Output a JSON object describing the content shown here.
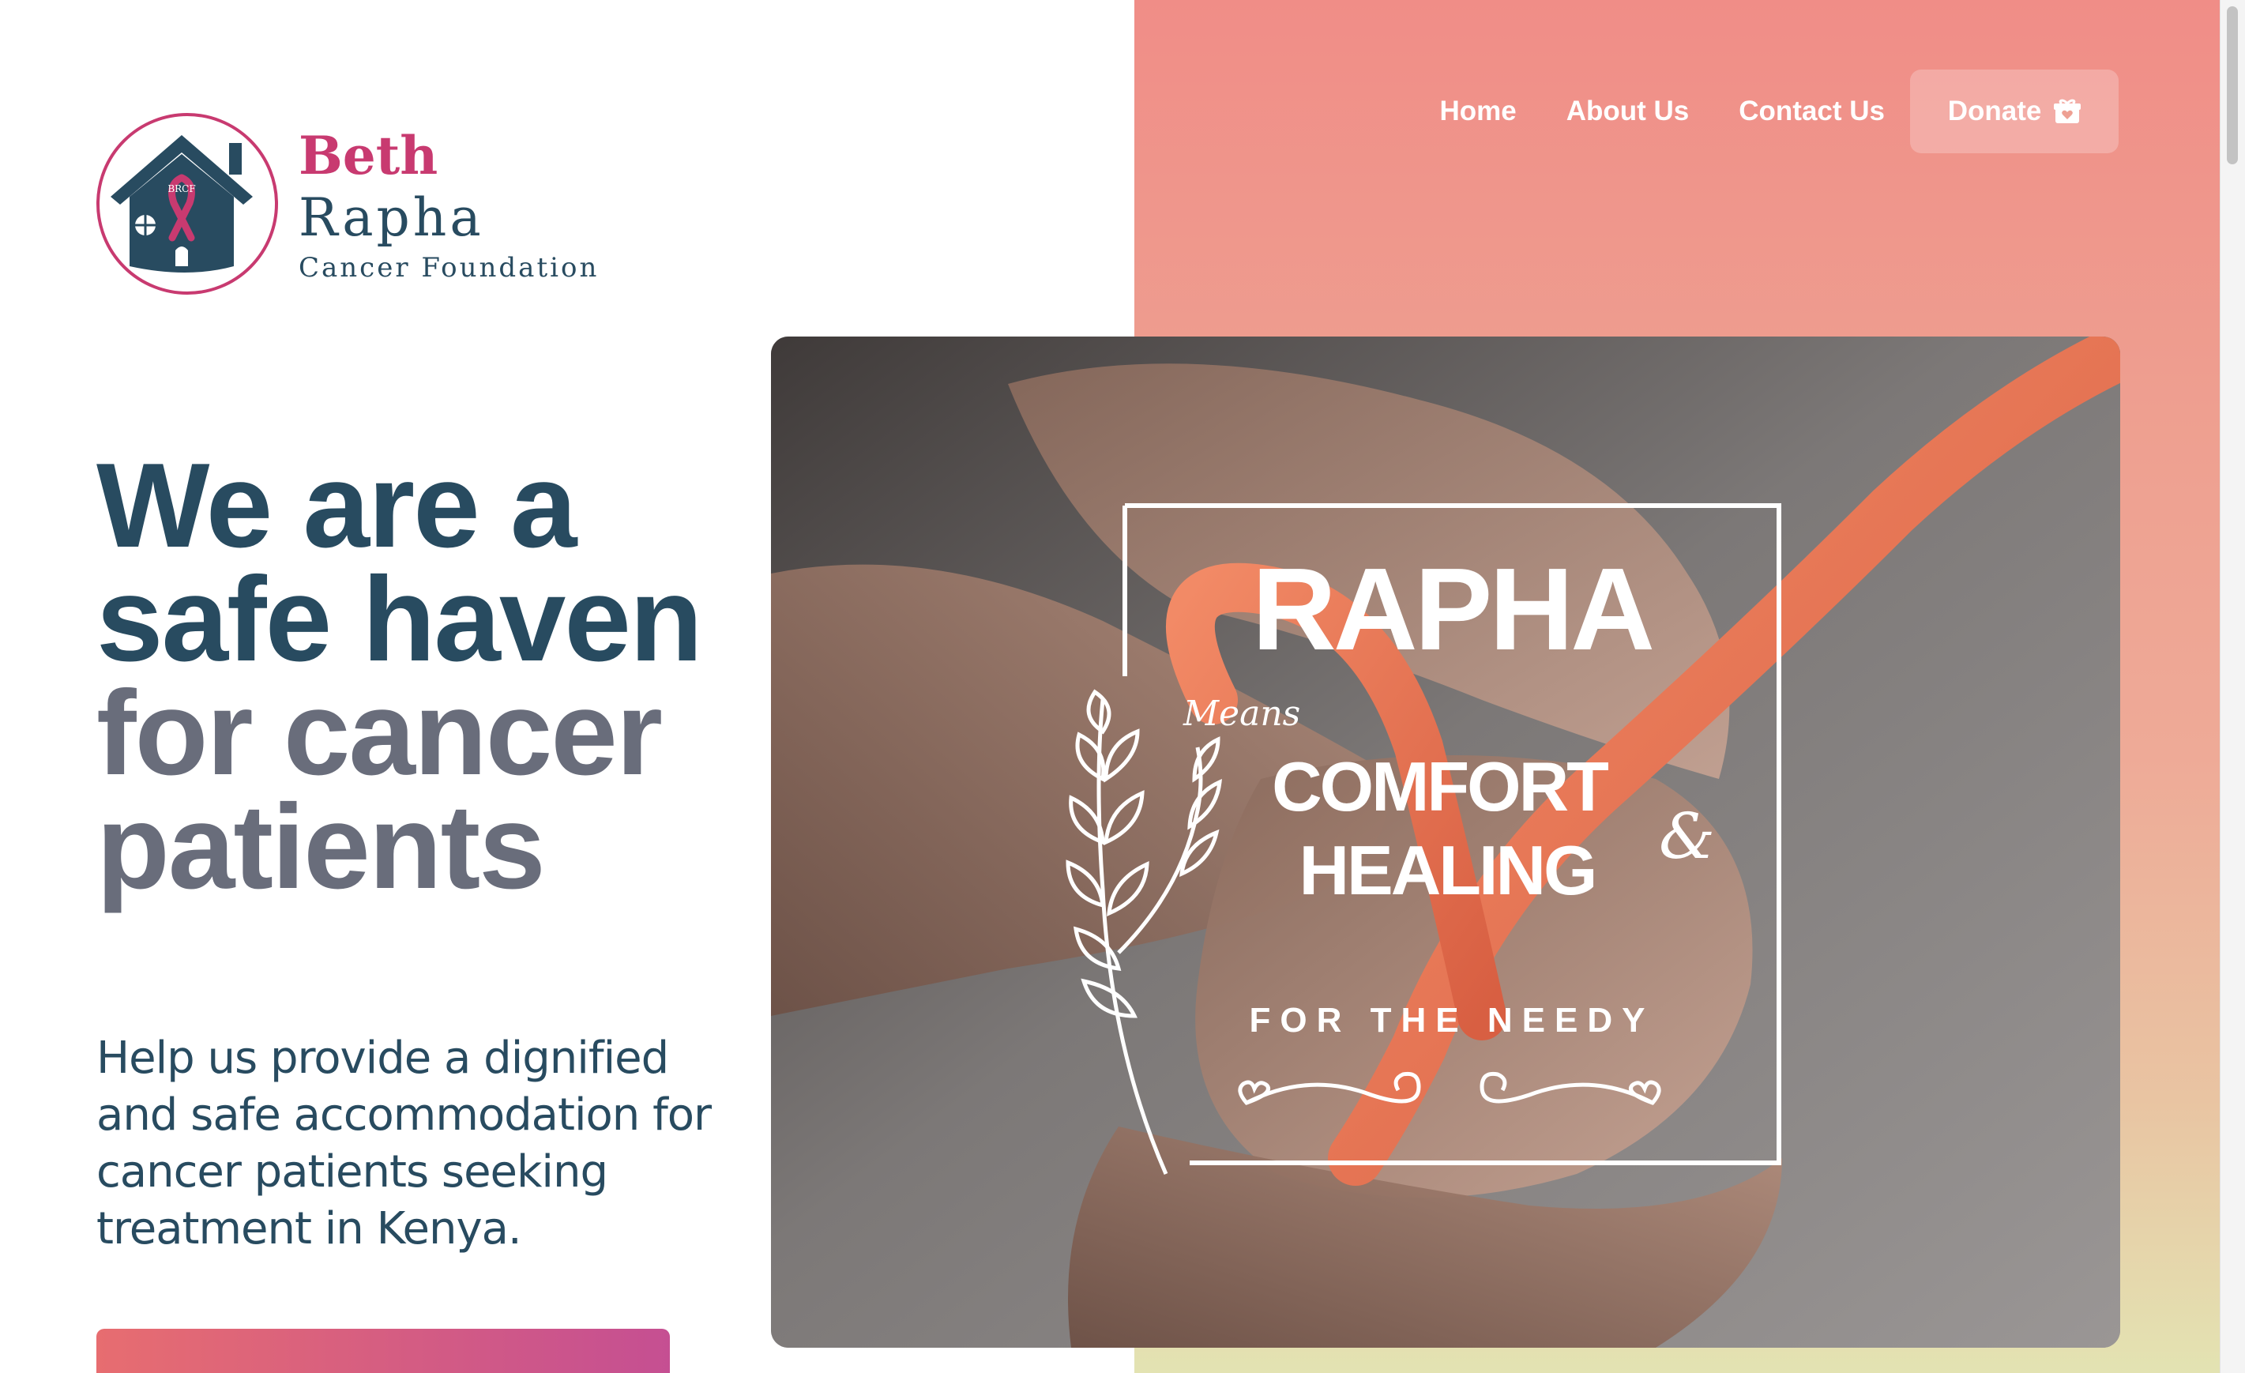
{
  "brand": {
    "name_first": "Beth",
    "name_second": "Rapha",
    "subtitle": "Cancer Foundation",
    "badge_text": "BRCF"
  },
  "nav": {
    "items": [
      {
        "label": "Home"
      },
      {
        "label": "About Us"
      },
      {
        "label": "Contact Us"
      }
    ],
    "donate_label": "Donate",
    "donate_icon": "gift-icon"
  },
  "hero": {
    "headline_line1": "We are a",
    "headline_line2": "safe haven",
    "headline_line3": "for cancer",
    "headline_line4": "patients",
    "subtext": "Help us provide a dignified and safe accommodation for cancer patients seeking treatment in Kenya."
  },
  "hero_image": {
    "title": "RAPHA",
    "means": "Means",
    "line1": "COMFORT",
    "ampersand": "&",
    "line2": "HEALING",
    "tagline": "FOR THE NEEDY"
  },
  "colors": {
    "brand_navy": "#284b60",
    "brand_pink": "#c83a70",
    "headline_gray": "#696d7b",
    "panel_top": "#f08d87",
    "panel_bottom": "#e3e3b2",
    "ribbon": "#ec7456"
  }
}
